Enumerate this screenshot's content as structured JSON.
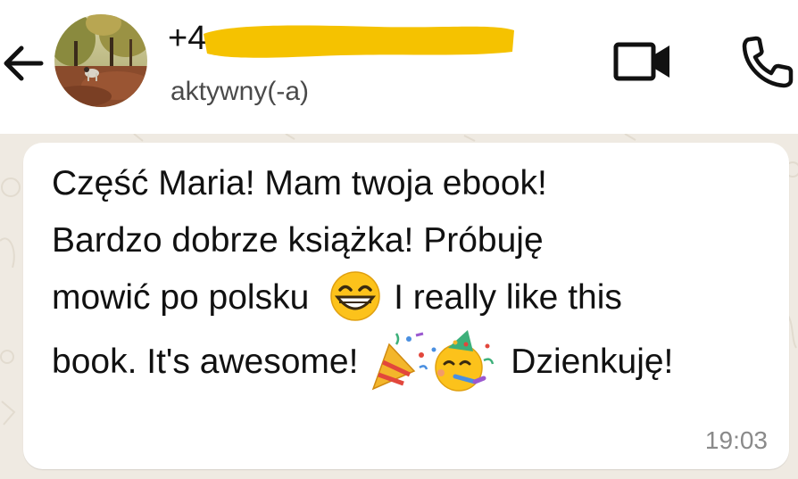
{
  "header": {
    "back_icon": "arrow-left-icon",
    "contact_name": "+4",
    "status": "aktywny(-a)",
    "video_icon": "video-camera-icon",
    "call_icon": "phone-icon",
    "redaction_color": "#f5c200"
  },
  "message": {
    "line1": "Część Maria! Mam twoja ebook!",
    "line2": "Bardzo dobrze książka! Próbuję",
    "line3_pre": "mowić po polsku",
    "line3_post": "I really like this",
    "line4_pre": "book. It's awesome!",
    "line4_post": "Dzienkuję!",
    "time": "19:03",
    "emojis": [
      "grinning-face-smiling-eyes-emoji",
      "party-popper-emoji",
      "partying-face-emoji"
    ]
  },
  "colors": {
    "chat_background": "#efeae2",
    "bubble": "#ffffff",
    "text": "#111111",
    "time": "#8a8a8a"
  }
}
